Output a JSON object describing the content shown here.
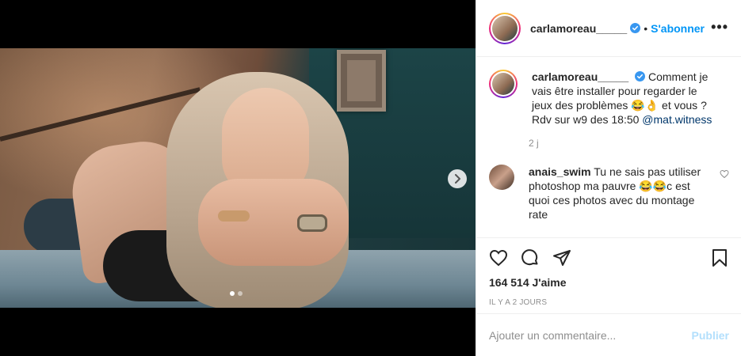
{
  "post": {
    "image_alt": "Photo de carlamoreau_____",
    "carousel": {
      "slide_count": 2,
      "active_slide": 1
    }
  },
  "header": {
    "username": "carlamoreau_____",
    "separator": "•",
    "follow_label": "S'abonner",
    "more_label": "•••"
  },
  "caption": {
    "username": "carlamoreau_____",
    "text": "Comment je vais être installer pour regarder le jeux des problèmes 😂👌 et vous ? Rdv sur w9 des 18:50",
    "mention": "@mat.witness",
    "time": "2 j"
  },
  "comments": [
    {
      "username": "anais_swim",
      "text": "Tu ne sais pas utiliser photoshop ma pauvre 😂😂c est quoi ces photos avec du montage rate"
    }
  ],
  "actions": {
    "likes": "164 514 J'aime",
    "time_ago": "IL Y A 2 JOURS"
  },
  "add_comment": {
    "placeholder": "Ajouter un commentaire...",
    "publish_label": "Publier"
  },
  "colors": {
    "accent": "#0095f6",
    "publish_disabled": "#b2dffc",
    "verified": "#3897f0"
  },
  "icons": [
    "verified-badge-icon",
    "more-options-icon",
    "chevron-right-icon",
    "heart-icon",
    "comment-icon",
    "share-icon",
    "bookmark-icon"
  ]
}
